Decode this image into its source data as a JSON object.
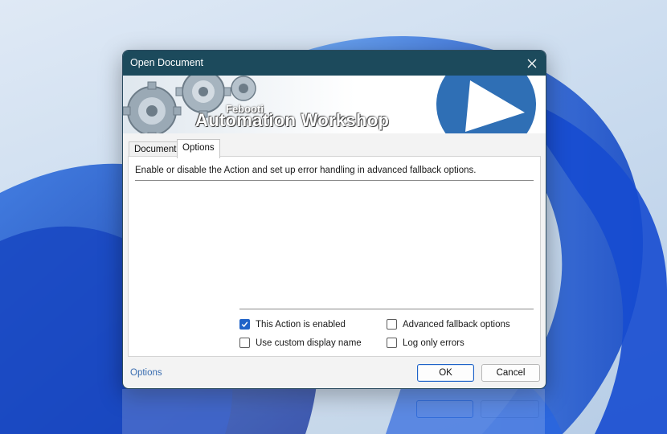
{
  "dialog": {
    "title": "Open Document",
    "close_icon": "close-icon"
  },
  "banner": {
    "brand_small": "Febooti",
    "brand_big": "Automation Workshop",
    "icons": [
      "gear-icon",
      "play-icon"
    ]
  },
  "tabs": [
    {
      "label": "Document",
      "active": false
    },
    {
      "label": "Options",
      "active": true
    }
  ],
  "options_panel": {
    "description": "Enable or disable the Action and set up error handling in advanced fallback options.",
    "checkboxes": [
      {
        "label": "This Action is enabled",
        "checked": true
      },
      {
        "label": "Use custom display name",
        "checked": false
      },
      {
        "label": "Advanced fallback options",
        "checked": false
      },
      {
        "label": "Log only errors",
        "checked": false
      }
    ]
  },
  "footer": {
    "options_link": "Options",
    "ok_label": "OK",
    "cancel_label": "Cancel"
  },
  "colors": {
    "titlebar": "#1c4a5c",
    "accent": "#1f63c8",
    "banner_circle": "#2f6fb5",
    "link": "#3a6db0"
  }
}
